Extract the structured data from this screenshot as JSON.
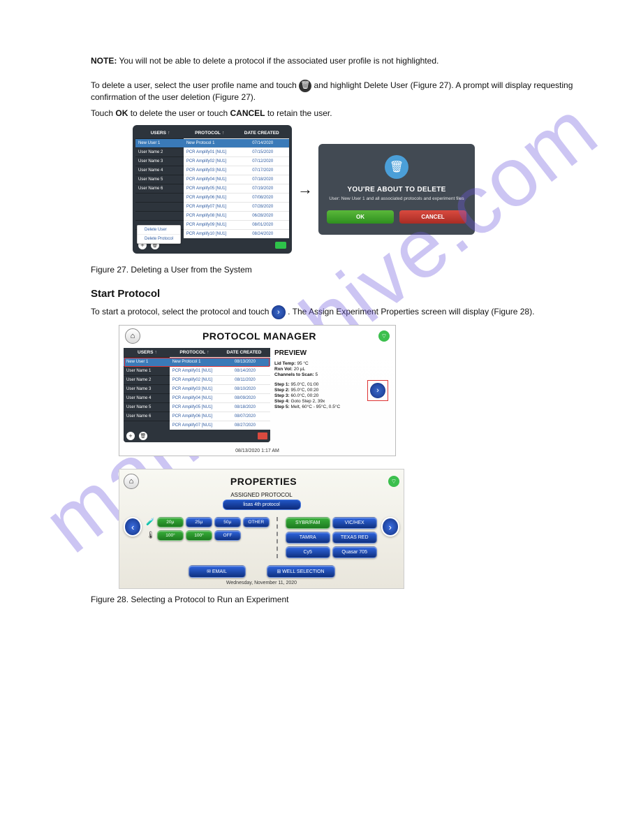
{
  "section": {
    "noteLead": "NOTE:",
    "note": "You will not be able to delete a protocol if the associated user profile is not highlighted.",
    "deleteUserP1": "To delete a user, select the user profile name and touch",
    "deleteUserP2": "and highlight Delete User (Figure 27). A prompt will display requesting confirmation of the user deletion (Figure 27).",
    "deleteUserP3a": "Touch",
    "deleteUserOk": "OK",
    "deleteUserP3b": "to delete the user or touch",
    "deleteUserCancel": "CANCEL",
    "deleteUserP3c": "to retain the user.",
    "figure27": "Figure 27. Deleting a User from the System",
    "startHead": "Start Protocol",
    "startP1a": "To start a protocol, select the protocol and touch",
    "startP1b": ". The Assign Experiment Properties screen will display (Figure 28).",
    "figure28": "Figure 28. Selecting a Protocol to Run an Experiment"
  },
  "pm1": {
    "headers": {
      "users": "USERS",
      "protocol": "PROTOCOL",
      "date": "DATE CREATED"
    },
    "rows": [
      {
        "u": "New User 1",
        "p": "New Protocol 1",
        "d": "07/14/2020",
        "sel": true
      },
      {
        "u": "User Name 2",
        "p": "PCR Amplify01 [NU1]",
        "d": "07/15/2020"
      },
      {
        "u": "User Name 3",
        "p": "PCR Amplify02 [NU1]",
        "d": "07/12/2020"
      },
      {
        "u": "User Name 4",
        "p": "PCR Amplify03 [NU1]",
        "d": "07/17/2020"
      },
      {
        "u": "User Name 5",
        "p": "PCR Amplify04 [NU1]",
        "d": "07/18/2020"
      },
      {
        "u": "User Name 6",
        "p": "PCR Amplify05 [NU1]",
        "d": "07/19/2020"
      },
      {
        "u": "",
        "p": "PCR Amplify06 [NU1]",
        "d": "07/08/2020"
      },
      {
        "u": "",
        "p": "PCR Amplify07 [NU1]",
        "d": "07/28/2020"
      },
      {
        "u": "",
        "p": "PCR Amplify08 [NU1]",
        "d": "06/28/2020"
      },
      {
        "u": "",
        "p": "PCR Amplify09 [NU1]",
        "d": "08/01/2020"
      },
      {
        "u": "",
        "p": "PCR Amplify10 [NU1]",
        "d": "08/24/2020"
      }
    ],
    "popup": {
      "deleteUser": "Delete User",
      "deleteProtocol": "Delete Protocol"
    }
  },
  "dialog": {
    "title": "YOU'RE ABOUT TO DELETE",
    "sub": "User: New User 1 and all associated protocols and experiment files",
    "ok": "OK",
    "cancel": "CANCEL"
  },
  "pm2": {
    "title": "PROTOCOL MANAGER",
    "headers": {
      "users": "USERS",
      "protocol": "PROTOCOL",
      "date": "DATE CREATED"
    },
    "rows": [
      {
        "u": "New User 1",
        "p": "New Protocol 1",
        "d": "08/13/2020",
        "sel": true
      },
      {
        "u": "User Name 1",
        "p": "PCR Amplify01 [NU1]",
        "d": "08/14/2020"
      },
      {
        "u": "User Name 2",
        "p": "PCR Amplify02 [NU1]",
        "d": "08/11/2020"
      },
      {
        "u": "User Name 3",
        "p": "PCR Amplify03 [NU1]",
        "d": "08/10/2020"
      },
      {
        "u": "User Name 4",
        "p": "PCR Amplify04 [NU1]",
        "d": "08/09/2020"
      },
      {
        "u": "User Name 5",
        "p": "PCR Amplify05 [NU1]",
        "d": "08/18/2020"
      },
      {
        "u": "User Name 6",
        "p": "PCR Amplify06 [NU1]",
        "d": "08/07/2020"
      },
      {
        "u": "",
        "p": "PCR Amplify07 [NU1]",
        "d": "08/27/2020"
      }
    ],
    "preview": {
      "title": "PREVIEW",
      "lidTempL": "Lid Temp:",
      "lidTempV": "95 °C",
      "rxnVolL": "Rxn Vol:",
      "rxnVolV": "20 µL",
      "chanL": "Channels to Scan:",
      "chanV": "5",
      "steps": [
        "Step 1: 95.0°C, 01:00",
        "Step 2: 95.0°C, 00:20",
        "Step 3: 60.0°C, 00:20",
        "Step 4: Goto Step 2, 39x",
        "Step 5: Melt, 60°C - 95°C, 0.5°C"
      ]
    },
    "timestamp": "08/13/2020 1:17 AM"
  },
  "props": {
    "title": "PROPERTIES",
    "assignedLabel": "ASSIGNED PROTOCOL",
    "assigned": "lisas 4th protocol",
    "vol": {
      "a": "20µ",
      "b": "25µ",
      "c": "50µ",
      "d": "OTHER"
    },
    "temp": {
      "a": "100°",
      "b": "100°",
      "c": "OFF"
    },
    "dyes": {
      "a": "SYBR/FAM",
      "b": "VIC/HEX",
      "c": "TAMRA",
      "d": "TEXAS RED",
      "e": "Cy5",
      "f": "Quasar 705"
    },
    "email": "✉ EMAIL",
    "wells": "⊞ WELL SELECTION",
    "timestamp": "Wednesday, November 11, 2020"
  }
}
